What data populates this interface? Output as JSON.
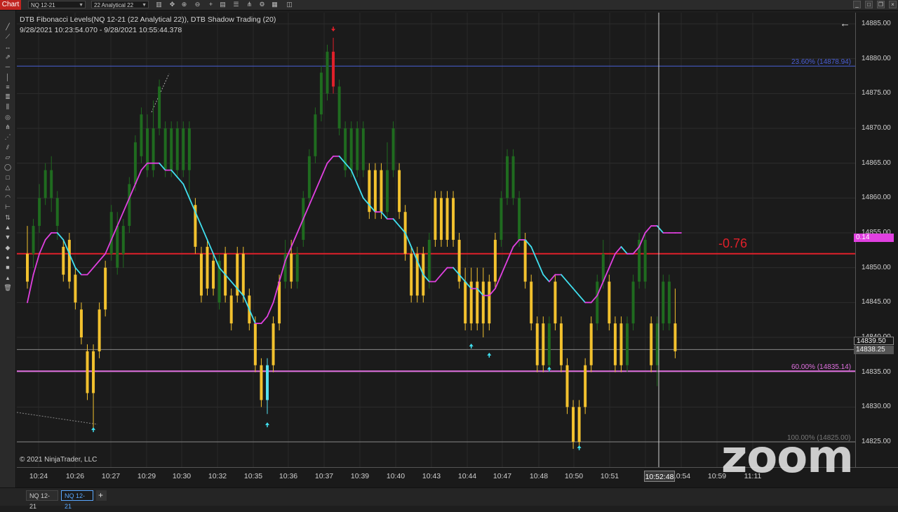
{
  "toolbar": {
    "chart_tab": "Chart",
    "instrument_select": "NQ 12-21",
    "interval_select": "22 Analytical 22",
    "icons": [
      "bar-type-icon",
      "crosshair-icon",
      "zoom-in-icon",
      "zoom-out-icon",
      "add-icon",
      "data-box-icon",
      "properties-icon",
      "indicators-icon",
      "strategies-icon",
      "chart-trader-icon",
      "snapshot-icon",
      "share-icon"
    ],
    "window_controls": [
      "minimize",
      "maximize",
      "close"
    ]
  },
  "left_tools": [
    "line-tool",
    "ray-tool",
    "extended-line-tool",
    "arrow-line-tool",
    "horizontal-line-tool",
    "vertical-line-tool",
    "fib-retracement-tool",
    "fib-extension-tool",
    "fib-time-tool",
    "fib-circle-tool",
    "andrews-pitchfork-tool",
    "gann-fan-tool",
    "regression-channel-tool",
    "trend-channel-tool",
    "ellipse-tool",
    "rectangle-tool",
    "triangle-tool",
    "arc-tool",
    "ruler-tool",
    "risk-reward-tool",
    "arrow-up-tool",
    "arrow-down-tool",
    "diamond-tool",
    "dot-tool",
    "square-tool",
    "triangle-marker-tool",
    "delete-tool"
  ],
  "info": {
    "line1": "DTB Fibonacci Levels(NQ 12-21 (22 Analytical 22)), DTB Shadow Trading (20)",
    "line2": "9/28/2021 10:23:54.070 - 9/28/2021 10:55:44.378"
  },
  "fib_levels": [
    {
      "label": "23.60% (14878.94)",
      "price": 14878.94,
      "color": "#4a5fd8"
    },
    {
      "label": "60.00% (14835.14)",
      "price": 14835.14,
      "color": "#e070e0"
    },
    {
      "label": "100.00% (14825.00)",
      "price": 14825.0,
      "color": "#888888"
    }
  ],
  "red_line": {
    "price": 14852.0,
    "color": "#e0202a"
  },
  "gray_line": {
    "price": 14838.25,
    "color": "#888888"
  },
  "price_ticks": [
    "14885.00",
    "14880.00",
    "14875.00",
    "14870.00",
    "14865.00",
    "14860.00",
    "14855.00",
    "14850.00",
    "14845.00",
    "14840.00",
    "14835.00",
    "14830.00",
    "14825.00"
  ],
  "badges": {
    "indicator_value": "0.14",
    "last_price": "14839.50",
    "gray_price": "14838.25"
  },
  "big_value": "-0.76",
  "time_ticks": [
    "10:24",
    "10:26",
    "10:27",
    "10:29",
    "10:30",
    "10:32",
    "10:35",
    "10:36",
    "10:37",
    "10:39",
    "10:40",
    "10:43",
    "10:44",
    "10:47",
    "10:48",
    "10:50",
    "10:51",
    "10:54",
    "10:59",
    "11:11"
  ],
  "cursor_time": "10:52:48",
  "copyright": "© 2021 NinjaTrader, LLC",
  "tabs": [
    "NQ 12-21",
    "NQ 12-21"
  ],
  "add_tab": "+",
  "zoom_watermark": "zoom",
  "colors": {
    "up_bar": "#1f6b1f",
    "down_bar": "#f2c12e",
    "cyan_bar": "#55e0f0",
    "red_bar": "#e0202a",
    "ma_up": "#e040e0",
    "ma_down": "#40e0f0",
    "cursor": "#d0d0d0"
  },
  "bars": [
    {
      "o": 14852,
      "c": 14848,
      "h": 14856,
      "l": 14847,
      "t": "d"
    },
    {
      "o": 14852,
      "c": 14856,
      "h": 14857,
      "l": 14850,
      "t": "u"
    },
    {
      "o": 14856,
      "c": 14860,
      "h": 14862,
      "l": 14855,
      "t": "u"
    },
    {
      "o": 14860,
      "c": 14864,
      "h": 14865,
      "l": 14859,
      "t": "u"
    },
    {
      "o": 14864,
      "c": 14860,
      "h": 14866,
      "l": 14858,
      "t": "u"
    },
    {
      "o": 14860,
      "c": 14856,
      "h": 14861,
      "l": 14854,
      "t": "u"
    },
    {
      "o": 14853,
      "c": 14849,
      "h": 14854,
      "l": 14848,
      "t": "d"
    },
    {
      "o": 14854,
      "c": 14848,
      "h": 14855,
      "l": 14847,
      "t": "d"
    },
    {
      "o": 14849,
      "c": 14845,
      "h": 14850,
      "l": 14844,
      "t": "d"
    },
    {
      "o": 14844,
      "c": 14840,
      "h": 14845,
      "l": 14839,
      "t": "d"
    },
    {
      "o": 14838,
      "c": 14832,
      "h": 14839,
      "l": 14831,
      "t": "d"
    },
    {
      "o": 14838,
      "c": 14832,
      "h": 14839,
      "l": 14827,
      "t": "d"
    },
    {
      "o": 14838,
      "c": 14844,
      "h": 14845,
      "l": 14837,
      "t": "d"
    },
    {
      "o": 14844,
      "c": 14850,
      "h": 14851,
      "l": 14843,
      "t": "d"
    },
    {
      "o": 14852,
      "c": 14858,
      "h": 14859,
      "l": 14851,
      "t": "u"
    },
    {
      "o": 14856,
      "c": 14850,
      "h": 14858,
      "l": 14849,
      "t": "u"
    },
    {
      "o": 14852,
      "c": 14856,
      "h": 14857,
      "l": 14850,
      "t": "u"
    },
    {
      "o": 14856,
      "c": 14862,
      "h": 14863,
      "l": 14855,
      "t": "u"
    },
    {
      "o": 14862,
      "c": 14868,
      "h": 14869,
      "l": 14861,
      "t": "u"
    },
    {
      "o": 14866,
      "c": 14872,
      "h": 14873,
      "l": 14865,
      "t": "u"
    },
    {
      "o": 14870,
      "c": 14864,
      "h": 14872,
      "l": 14863,
      "t": "u"
    },
    {
      "o": 14864,
      "c": 14870,
      "h": 14874,
      "l": 14863,
      "t": "u"
    },
    {
      "o": 14870,
      "c": 14876,
      "h": 14877,
      "l": 14869,
      "t": "u"
    },
    {
      "o": 14870,
      "c": 14864,
      "h": 14871,
      "l": 14863,
      "t": "u"
    },
    {
      "o": 14864,
      "c": 14870,
      "h": 14871,
      "l": 14863,
      "t": "u"
    },
    {
      "o": 14870,
      "c": 14864,
      "h": 14871,
      "l": 14863,
      "t": "u"
    },
    {
      "o": 14864,
      "c": 14870,
      "h": 14871,
      "l": 14863,
      "t": "u"
    },
    {
      "o": 14870,
      "c": 14864,
      "h": 14871,
      "l": 14860,
      "t": "u"
    },
    {
      "o": 14859,
      "c": 14853,
      "h": 14860,
      "l": 14852,
      "t": "d"
    },
    {
      "o": 14852,
      "c": 14846,
      "h": 14853,
      "l": 14845,
      "t": "d"
    },
    {
      "o": 14853,
      "c": 14847,
      "h": 14854,
      "l": 14846,
      "t": "d"
    },
    {
      "o": 14851,
      "c": 14847,
      "h": 14852,
      "l": 14846,
      "t": "d"
    },
    {
      "o": 14845,
      "c": 14851,
      "h": 14852,
      "l": 14844,
      "t": "u"
    },
    {
      "o": 14852,
      "c": 14846,
      "h": 14853,
      "l": 14845,
      "t": "d"
    },
    {
      "o": 14846,
      "c": 14842,
      "h": 14847,
      "l": 14841,
      "t": "d"
    },
    {
      "o": 14846,
      "c": 14852,
      "h": 14853,
      "l": 14845,
      "t": "d"
    },
    {
      "o": 14852,
      "c": 14846,
      "h": 14853,
      "l": 14845,
      "t": "d"
    },
    {
      "o": 14846,
      "c": 14842,
      "h": 14847,
      "l": 14841,
      "t": "d"
    },
    {
      "o": 14842,
      "c": 14836,
      "h": 14843,
      "l": 14835,
      "t": "d"
    },
    {
      "o": 14836,
      "c": 14831,
      "h": 14837,
      "l": 14830,
      "t": "d"
    },
    {
      "o": 14836,
      "c": 14831,
      "h": 14837,
      "l": 14829,
      "t": "c"
    },
    {
      "o": 14836,
      "c": 14842,
      "h": 14843,
      "l": 14835,
      "t": "d"
    },
    {
      "o": 14842,
      "c": 14848,
      "h": 14849,
      "l": 14841,
      "t": "d"
    },
    {
      "o": 14848,
      "c": 14852,
      "h": 14854,
      "l": 14847,
      "t": "u"
    },
    {
      "o": 14848,
      "c": 14852,
      "h": 14854,
      "l": 14847,
      "t": "d"
    },
    {
      "o": 14852,
      "c": 14848,
      "h": 14853,
      "l": 14847,
      "t": "u"
    },
    {
      "o": 14854,
      "c": 14860,
      "h": 14861,
      "l": 14853,
      "t": "u"
    },
    {
      "o": 14860,
      "c": 14866,
      "h": 14867,
      "l": 14859,
      "t": "u"
    },
    {
      "o": 14866,
      "c": 14872,
      "h": 14873,
      "l": 14865,
      "t": "u"
    },
    {
      "o": 14872,
      "c": 14878,
      "h": 14879,
      "l": 14871,
      "t": "u"
    },
    {
      "o": 14875,
      "c": 14881,
      "h": 14882,
      "l": 14874,
      "t": "u"
    },
    {
      "o": 14881,
      "c": 14876,
      "h": 14883,
      "l": 14875,
      "t": "r"
    },
    {
      "o": 14876,
      "c": 14870,
      "h": 14877,
      "l": 14869,
      "t": "u"
    },
    {
      "o": 14870,
      "c": 14864,
      "h": 14871,
      "l": 14863,
      "t": "u"
    },
    {
      "o": 14864,
      "c": 14870,
      "h": 14871,
      "l": 14863,
      "t": "u"
    },
    {
      "o": 14870,
      "c": 14864,
      "h": 14871,
      "l": 14863,
      "t": "u"
    },
    {
      "o": 14864,
      "c": 14870,
      "h": 14871,
      "l": 14863,
      "t": "u"
    },
    {
      "o": 14864,
      "c": 14858,
      "h": 14865,
      "l": 14857,
      "t": "d"
    },
    {
      "o": 14864,
      "c": 14858,
      "h": 14865,
      "l": 14857,
      "t": "d"
    },
    {
      "o": 14864,
      "c": 14858,
      "h": 14865,
      "l": 14857,
      "t": "d"
    },
    {
      "o": 14858,
      "c": 14864,
      "h": 14868,
      "l": 14857,
      "t": "u"
    },
    {
      "o": 14864,
      "c": 14870,
      "h": 14871,
      "l": 14863,
      "t": "u"
    },
    {
      "o": 14864,
      "c": 14858,
      "h": 14865,
      "l": 14857,
      "t": "d"
    },
    {
      "o": 14858,
      "c": 14852,
      "h": 14859,
      "l": 14851,
      "t": "d"
    },
    {
      "o": 14852,
      "c": 14846,
      "h": 14853,
      "l": 14845,
      "t": "d"
    },
    {
      "o": 14852,
      "c": 14846,
      "h": 14853,
      "l": 14845,
      "t": "d"
    },
    {
      "o": 14852,
      "c": 14846,
      "h": 14853,
      "l": 14845,
      "t": "d"
    },
    {
      "o": 14848,
      "c": 14854,
      "h": 14855,
      "l": 14847,
      "t": "u"
    },
    {
      "o": 14854,
      "c": 14860,
      "h": 14861,
      "l": 14853,
      "t": "d"
    },
    {
      "o": 14860,
      "c": 14854,
      "h": 14861,
      "l": 14853,
      "t": "d"
    },
    {
      "o": 14860,
      "c": 14854,
      "h": 14861,
      "l": 14853,
      "t": "d"
    },
    {
      "o": 14860,
      "c": 14854,
      "h": 14861,
      "l": 14853,
      "t": "d"
    },
    {
      "o": 14854,
      "c": 14848,
      "h": 14855,
      "l": 14847,
      "t": "d"
    },
    {
      "o": 14848,
      "c": 14842,
      "h": 14850,
      "l": 14841,
      "t": "d"
    },
    {
      "o": 14848,
      "c": 14842,
      "h": 14850,
      "l": 14841,
      "t": "d"
    },
    {
      "o": 14848,
      "c": 14842,
      "h": 14850,
      "l": 14841,
      "t": "d"
    },
    {
      "o": 14848,
      "c": 14842,
      "h": 14850,
      "l": 14840,
      "t": "d"
    },
    {
      "o": 14842,
      "c": 14848,
      "h": 14849,
      "l": 14841,
      "t": "d"
    },
    {
      "o": 14848,
      "c": 14854,
      "h": 14855,
      "l": 14847,
      "t": "d"
    },
    {
      "o": 14854,
      "c": 14860,
      "h": 14861,
      "l": 14853,
      "t": "u"
    },
    {
      "o": 14860,
      "c": 14866,
      "h": 14867,
      "l": 14859,
      "t": "u"
    },
    {
      "o": 14866,
      "c": 14860,
      "h": 14867,
      "l": 14859,
      "t": "u"
    },
    {
      "o": 14860,
      "c": 14854,
      "h": 14861,
      "l": 14853,
      "t": "u"
    },
    {
      "o": 14854,
      "c": 14848,
      "h": 14855,
      "l": 14847,
      "t": "d"
    },
    {
      "o": 14848,
      "c": 14842,
      "h": 14849,
      "l": 14841,
      "t": "d"
    },
    {
      "o": 14842,
      "c": 14836,
      "h": 14843,
      "l": 14835,
      "t": "d"
    },
    {
      "o": 14842,
      "c": 14836,
      "h": 14843,
      "l": 14835,
      "t": "d"
    },
    {
      "o": 14836,
      "c": 14842,
      "h": 14843,
      "l": 14835,
      "t": "u"
    },
    {
      "o": 14842,
      "c": 14848,
      "h": 14849,
      "l": 14841,
      "t": "d"
    },
    {
      "o": 14842,
      "c": 14836,
      "h": 14843,
      "l": 14835,
      "t": "d"
    },
    {
      "o": 14836,
      "c": 14830,
      "h": 14837,
      "l": 14829,
      "t": "d"
    },
    {
      "o": 14830,
      "c": 14825,
      "h": 14831,
      "l": 14824,
      "t": "d"
    },
    {
      "o": 14830,
      "c": 14825,
      "h": 14831,
      "l": 14824,
      "t": "d"
    },
    {
      "o": 14830,
      "c": 14836,
      "h": 14837,
      "l": 14829,
      "t": "d"
    },
    {
      "o": 14836,
      "c": 14842,
      "h": 14843,
      "l": 14835,
      "t": "d"
    },
    {
      "o": 14842,
      "c": 14848,
      "h": 14849,
      "l": 14841,
      "t": "u"
    },
    {
      "o": 14848,
      "c": 14852,
      "h": 14854,
      "l": 14847,
      "t": "u"
    },
    {
      "o": 14848,
      "c": 14842,
      "h": 14849,
      "l": 14841,
      "t": "d"
    },
    {
      "o": 14842,
      "c": 14836,
      "h": 14843,
      "l": 14835,
      "t": "d"
    },
    {
      "o": 14842,
      "c": 14836,
      "h": 14843,
      "l": 14835,
      "t": "d"
    },
    {
      "o": 14836,
      "c": 14842,
      "h": 14843,
      "l": 14835,
      "t": "u"
    },
    {
      "o": 14842,
      "c": 14848,
      "h": 14849,
      "l": 14841,
      "t": "u"
    },
    {
      "o": 14848,
      "c": 14854,
      "h": 14855,
      "l": 14847,
      "t": "u"
    },
    {
      "o": 14848,
      "c": 14854,
      "h": 14855,
      "l": 14847,
      "t": "u"
    },
    {
      "o": 14842,
      "c": 14836,
      "h": 14843,
      "l": 14835,
      "t": "d"
    },
    {
      "o": 14842,
      "c": 14836,
      "h": 14843,
      "l": 14833,
      "t": "u"
    },
    {
      "o": 14842,
      "c": 14848,
      "h": 14849,
      "l": 14841,
      "t": "u"
    },
    {
      "o": 14842,
      "c": 14848,
      "h": 14849,
      "l": 14841,
      "t": "u"
    },
    {
      "o": 14842,
      "c": 14838,
      "h": 14847,
      "l": 14837,
      "t": "d"
    }
  ],
  "ma": [
    14845,
    14849,
    14852,
    14854,
    14855,
    14855,
    14854,
    14852,
    14850,
    14849,
    14849,
    14850,
    14851,
    14852,
    14854,
    14856,
    14858,
    14860,
    14862,
    14864,
    14865,
    14865,
    14865,
    14864,
    14864,
    14863,
    14862,
    14860,
    14858,
    14856,
    14854,
    14852,
    14850,
    14849,
    14848,
    14847,
    14846,
    14844,
    14842,
    14842,
    14843,
    14845,
    14848,
    14851,
    14853,
    14855,
    14857,
    14859,
    14861,
    14863,
    14865,
    14866,
    14866,
    14865,
    14864,
    14862,
    14860,
    14859,
    14858,
    14858,
    14857,
    14857,
    14856,
    14855,
    14853,
    14851,
    14849,
    14848,
    14848,
    14849,
    14850,
    14850,
    14849,
    14848,
    14847,
    14847,
    14846,
    14846,
    14847,
    14849,
    14851,
    14853,
    14854,
    14854,
    14853,
    14851,
    14849,
    14848,
    14849,
    14849,
    14848,
    14847,
    14846,
    14845,
    14845,
    14846,
    14848,
    14850,
    14852,
    14853,
    14852,
    14852,
    14853,
    14855,
    14856,
    14856,
    14855,
    14855,
    14855,
    14855
  ],
  "signals": [
    {
      "i": 11,
      "type": "up",
      "price": 14826.8
    },
    {
      "i": 40,
      "type": "up",
      "price": 14827.5
    },
    {
      "i": 51,
      "type": "down",
      "price": 14884.2
    },
    {
      "i": 74,
      "type": "up",
      "price": 14838.8
    },
    {
      "i": 77,
      "type": "up",
      "price": 14837.5
    },
    {
      "i": 87,
      "type": "up",
      "price": 14835.5
    },
    {
      "i": 92,
      "type": "up",
      "price": 14824.2
    }
  ]
}
